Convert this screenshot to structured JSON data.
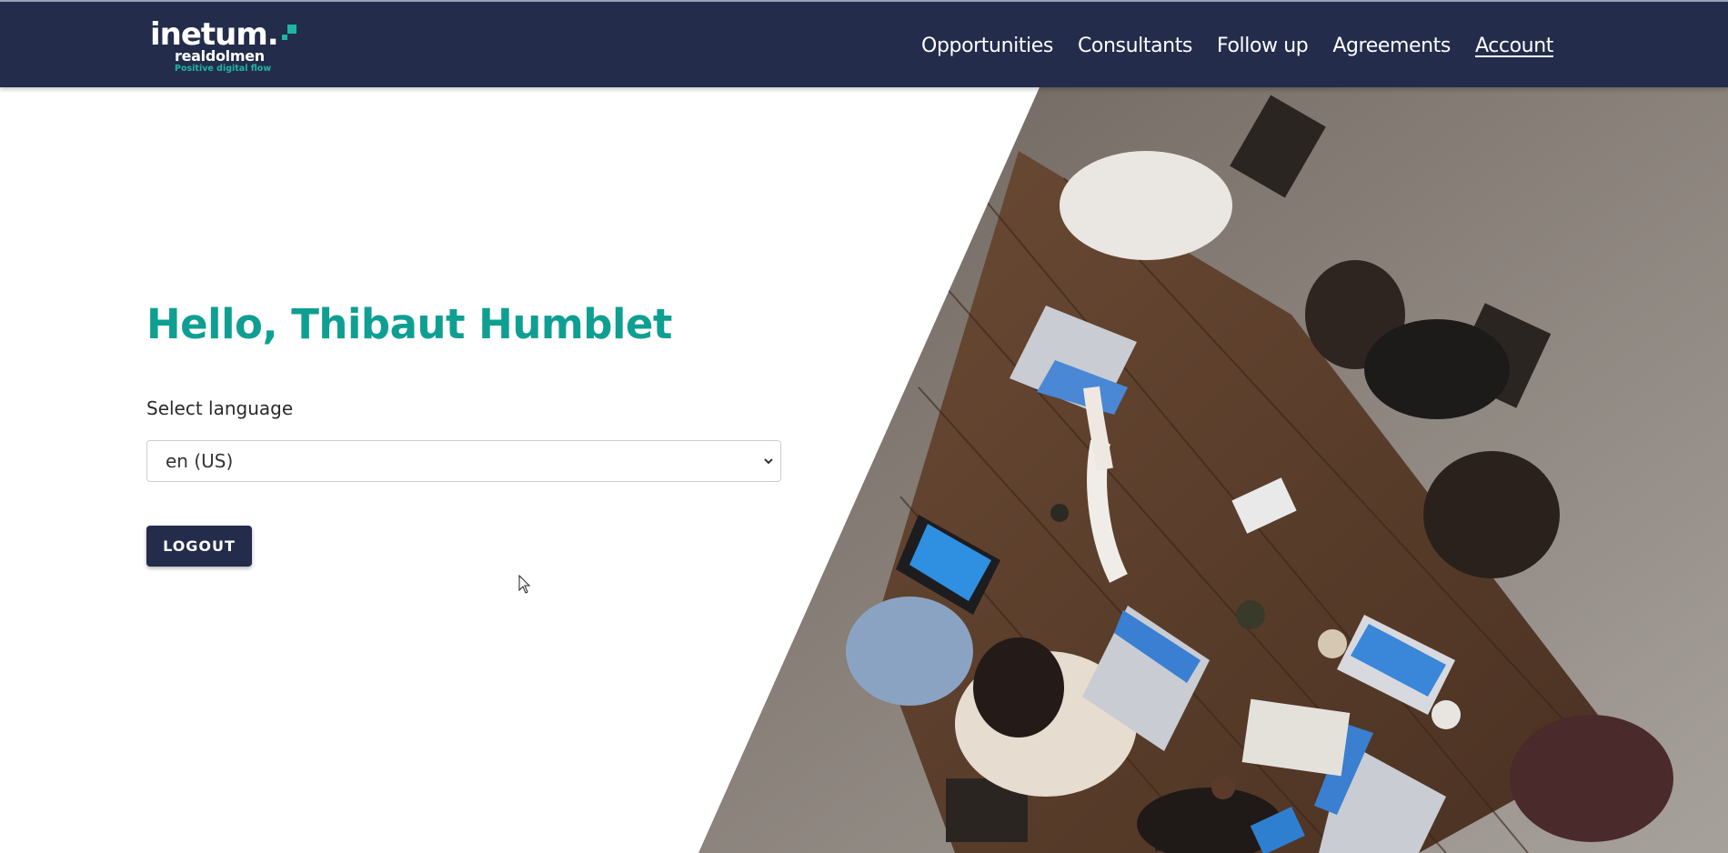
{
  "header": {
    "logo": {
      "brand": "inetum.",
      "sub": "realdolmen",
      "tagline": "Positive digital flow"
    },
    "nav": [
      {
        "label": "Opportunities",
        "active": false
      },
      {
        "label": "Consultants",
        "active": false
      },
      {
        "label": "Follow up",
        "active": false
      },
      {
        "label": "Agreements",
        "active": false
      },
      {
        "label": "Account",
        "active": true
      }
    ]
  },
  "main": {
    "greeting": "Hello, Thibaut Humblet",
    "language_label": "Select language",
    "language_value": "en (US)",
    "logout_label": "LOGOUT"
  },
  "colors": {
    "navy": "#232c4b",
    "teal": "#0f9f92",
    "teal_light": "#1fb5a5"
  },
  "icons": {
    "select": "chevron-down-icon",
    "cursor": "mouse-pointer-icon"
  }
}
